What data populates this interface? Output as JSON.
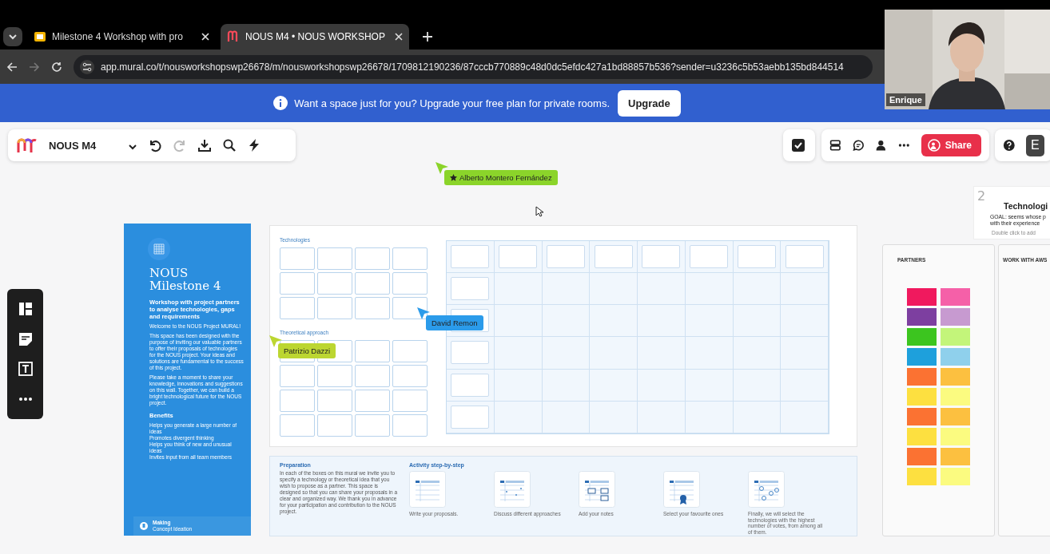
{
  "browser": {
    "tabs": [
      {
        "title": "Milestone 4 Workshop with pro",
        "kind": "slides",
        "selected": false
      },
      {
        "title": "NOUS M4 • NOUS WORKSHOP",
        "kind": "mural",
        "selected": true
      }
    ],
    "url": "app.mural.co/t/nousworkshopswp26678/m/nousworkshopswp26678/1709812190236/87cccb770889c48d0dc5efdc427a1bd88857b536?sender=u3236c5b53aebb135bd844514"
  },
  "banner": {
    "message": "Want a space just for you? Upgrade your free plan for private rooms.",
    "button": "Upgrade"
  },
  "toolbar": {
    "board_title": "NOUS M4",
    "share": "Share",
    "avatar": "E"
  },
  "collaborators": [
    {
      "name": "Alberto Montero Fernández",
      "color": "#8bd42a",
      "starred": true
    },
    {
      "name": "David Remon",
      "color": "#2b9bea",
      "starred": false
    },
    {
      "name": "Patrizio Dazzi",
      "color": "#bcd631",
      "starred": false
    }
  ],
  "intro_panel": {
    "title": "NOUS Milestone 4",
    "subtitle": "Workshop with project partners to analyse technologies, gaps and requirements",
    "paragraphs": [
      "Welcome to the NOUS Project MURAL!",
      "This space has been designed with the purpose of inviting our valuable partners to offer their proposals of technologies for the NOUS project. Your ideas and solutions are fundamental to the success of this project.",
      "Please take a moment to share your knowledge, innovations and suggestions on this wall. Together, we can build a bright technological future for the NOUS project."
    ],
    "benefits_title": "Benefits",
    "benefits": [
      "Helps you generate a large number of ideas",
      "Promotes divergent thinking",
      "Helps you think of new and unusual ideas",
      "Invites input from all team members"
    ],
    "footer_title": "Making",
    "footer_subtitle": "Concept Ideation"
  },
  "frame": {
    "sections": [
      "Technologies",
      "Theoretical approach"
    ]
  },
  "instructions": {
    "preparation_title": "Preparation",
    "preparation_text": "In each of the boxes on this mural we invite you to specify a technology or theoretical idea that you wish to propose as a partner. This space is designed so that you can share your proposals in a clear and organized way. We thank you in advance for your participation and contribution to the NOUS project.",
    "activity_title": "Activity step-by-step",
    "steps": [
      {
        "caption": "Write your proposals.",
        "kind": "plain"
      },
      {
        "caption": "Discuss different approaches",
        "kind": "dots"
      },
      {
        "caption": "Add your notes",
        "kind": "notes"
      },
      {
        "caption": "Select your favourite ones",
        "kind": "award"
      },
      {
        "caption": "Finally, we will select the technologies with the highest number of votes, from among all of them.",
        "kind": "votes"
      }
    ]
  },
  "next_area": {
    "number": "2",
    "title": "Technologi",
    "goal_lines": [
      "GOAL: seems whose p",
      "with their experience"
    ],
    "hint": "Double click to add"
  },
  "columns": [
    {
      "title": "PARTNERS",
      "stickies": [
        {
          "color": "#f0195e"
        },
        {
          "color": "#f560a8"
        },
        {
          "color": "#7d3fa0"
        },
        {
          "color": "#c79ad0"
        },
        {
          "color": "#3cc51f"
        },
        {
          "color": "#c3f57a"
        },
        {
          "color": "#1ea0dc"
        },
        {
          "color": "#8fd0ec"
        },
        {
          "color": "#fb7232"
        },
        {
          "color": "#fcc040"
        },
        {
          "color": "#fde040"
        },
        {
          "color": "#fbfb80"
        },
        {
          "color": "#fb7232"
        },
        {
          "color": "#fcc040"
        },
        {
          "color": "#fde040"
        },
        {
          "color": "#fbfb80"
        },
        {
          "color": "#fb7232"
        },
        {
          "color": "#fcc040"
        },
        {
          "color": "#fde040"
        },
        {
          "color": "#fbfb80"
        }
      ]
    },
    {
      "title": "WORK WITH AWS"
    }
  ],
  "video": {
    "name": "Enrique"
  }
}
